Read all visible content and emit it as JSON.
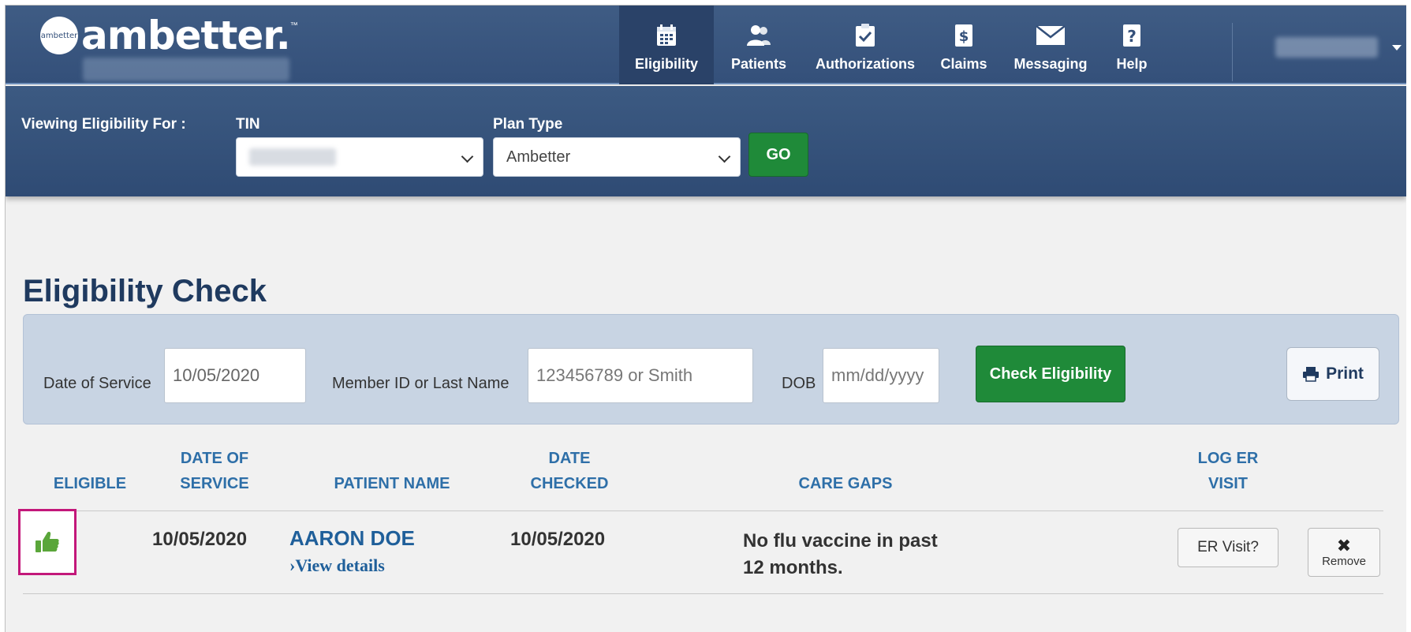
{
  "header": {
    "logo_badge": "ambetter",
    "logo_text": "ambetter.",
    "logo_tm": "™"
  },
  "nav": {
    "items": [
      {
        "label": "Eligibility",
        "icon": "calendar-icon",
        "active": true
      },
      {
        "label": "Patients",
        "icon": "people-icon",
        "active": false
      },
      {
        "label": "Authorizations",
        "icon": "clipboard-check-icon",
        "active": false
      },
      {
        "label": "Claims",
        "icon": "dollar-document-icon",
        "active": false
      },
      {
        "label": "Messaging",
        "icon": "envelope-icon",
        "active": false
      },
      {
        "label": "Help",
        "icon": "question-icon",
        "active": false
      }
    ]
  },
  "filter": {
    "viewing_label": "Viewing Eligibility For :",
    "tin_label": "TIN",
    "plan_type_label": "Plan Type",
    "plan_type_value": "Ambetter",
    "go_label": "GO"
  },
  "page": {
    "title": "Eligibility Check"
  },
  "search": {
    "dos_label": "Date of Service",
    "dos_value": "10/05/2020",
    "member_label": "Member ID or Last Name",
    "member_placeholder": "123456789 or Smith",
    "dob_label": "DOB",
    "dob_placeholder": "mm/dd/yyyy",
    "check_label": "Check Eligibility",
    "print_label": "Print"
  },
  "table": {
    "headers": {
      "eligible": "ELIGIBLE",
      "dos_line1": "DATE OF",
      "dos_line2": "SERVICE",
      "patient": "PATIENT NAME",
      "checked_line1": "DATE",
      "checked_line2": "CHECKED",
      "care_gaps": "CARE GAPS",
      "er_line1": "LOG ER",
      "er_line2": "VISIT"
    },
    "rows": [
      {
        "eligible_icon": "thumbs-up-icon",
        "date_of_service": "10/05/2020",
        "patient_name": "AARON DOE",
        "view_details": "›View details",
        "date_checked": "10/05/2020",
        "care_gap": "No flu vaccine in past 12 months.",
        "er_button": "ER Visit?",
        "remove_icon": "✖",
        "remove_label": "Remove"
      }
    ]
  },
  "colors": {
    "nav_bg": "#3f5c84",
    "accent_green": "#1f8a39",
    "header_blue": "#2e6fa8",
    "highlight_magenta": "#c3187a"
  }
}
